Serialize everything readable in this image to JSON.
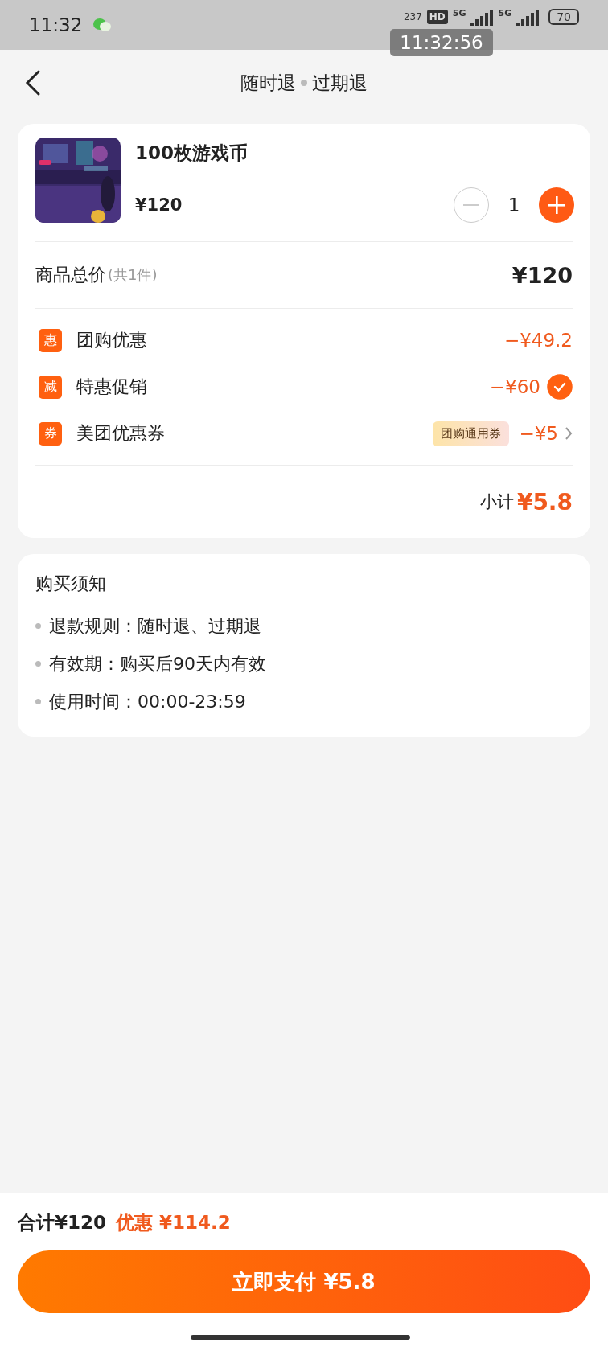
{
  "status_bar": {
    "time": "11:32",
    "network_speed": "237",
    "hd_badge": "HD",
    "network_type_1": "5G",
    "network_type_2": "5G",
    "battery": "70"
  },
  "recording_overlay": {
    "time": "11:32:56"
  },
  "header": {
    "title_left": "随时退",
    "title_right": "过期退"
  },
  "order": {
    "product": {
      "title": "100枚游戏币",
      "price": "¥120",
      "quantity": "1",
      "decrease_disabled": true
    },
    "total": {
      "label": "商品总价",
      "count": "(共1件)",
      "amount": "¥120"
    },
    "discounts": [
      {
        "kind": "plain",
        "badge": "惠",
        "label": "团购优惠",
        "amount": "−¥49.2"
      },
      {
        "kind": "toggle",
        "badge": "减",
        "label": "特惠促销",
        "amount": "−¥60",
        "checked": true
      },
      {
        "kind": "coupon",
        "badge": "券",
        "label": "美团优惠券",
        "tag": "团购通用券",
        "amount": "−¥5"
      }
    ],
    "subtotal": {
      "label": "小计",
      "amount": "¥5.8"
    }
  },
  "notice": {
    "title": "购买须知",
    "items": [
      "退款规则：随时退、过期退",
      "有效期：购买后90天内有效",
      "使用时间：00:00-23:59"
    ]
  },
  "footer": {
    "total": "合计¥120",
    "savings": "优惠 ¥114.2",
    "pay_button": "立即支付 ¥5.8"
  }
}
